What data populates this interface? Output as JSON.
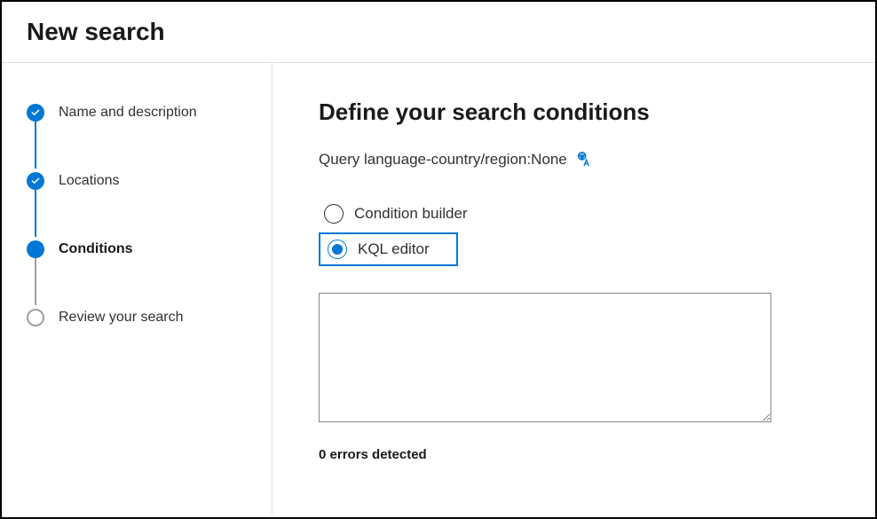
{
  "header": {
    "title": "New search"
  },
  "sidebar": {
    "steps": [
      {
        "label": "Name and description",
        "state": "completed"
      },
      {
        "label": "Locations",
        "state": "completed"
      },
      {
        "label": "Conditions",
        "state": "current"
      },
      {
        "label": "Review your search",
        "state": "upcoming"
      }
    ]
  },
  "main": {
    "heading": "Define your search conditions",
    "query_lang_label": "Query language-country/region: ",
    "query_lang_value": "None",
    "radio_options": {
      "condition_builder": "Condition builder",
      "kql_editor": "KQL editor"
    },
    "selected_option": "kql_editor",
    "editor_value": "",
    "editor_placeholder": "",
    "errors_text": "0 errors detected"
  },
  "colors": {
    "accent": "#0078d4",
    "border": "#e1dfdd",
    "text": "#323130",
    "muted": "#a19f9d"
  }
}
